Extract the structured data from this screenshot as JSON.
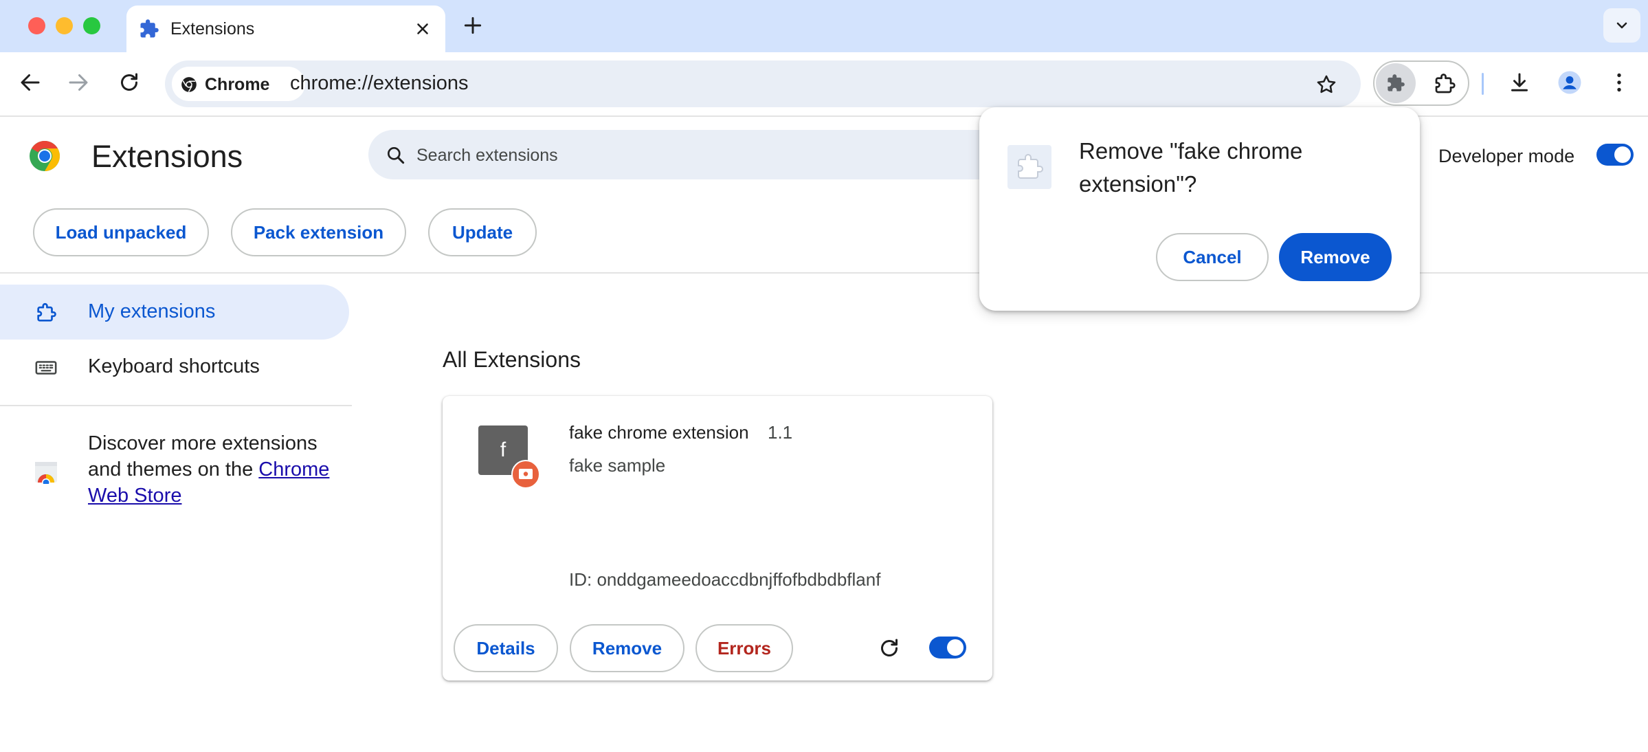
{
  "colors": {
    "accent": "#0b57d0",
    "tabstrip_bg": "#d3e3fd",
    "error_text": "#b3261e",
    "traffic_close": "#ff5f57",
    "traffic_min": "#febc2e",
    "traffic_max": "#28c840"
  },
  "browser": {
    "tab_title": "Extensions",
    "site_chip": "Chrome",
    "url": "chrome://extensions"
  },
  "page": {
    "title": "Extensions",
    "search_placeholder": "Search extensions",
    "developer_mode_label": "Developer mode",
    "developer_mode_on": true,
    "actions": {
      "load_unpacked": "Load unpacked",
      "pack_extension": "Pack extension",
      "update": "Update"
    }
  },
  "sidebar": {
    "items": [
      {
        "label": "My extensions",
        "icon": "extension-icon",
        "active": true
      },
      {
        "label": "Keyboard shortcuts",
        "icon": "keyboard-icon",
        "active": false
      }
    ],
    "discover_text": "Discover more extensions and themes on the ",
    "store_link": "Chrome Web Store"
  },
  "main": {
    "section_title": "All Extensions",
    "extension": {
      "icon_letter": "f",
      "name": "fake chrome extension",
      "version": "1.1",
      "description": "fake sample",
      "id_text": "ID: onddgameedoaccdbnjffofbdbdbflanf",
      "enabled": true,
      "buttons": {
        "details": "Details",
        "remove": "Remove",
        "errors": "Errors"
      }
    }
  },
  "dialog": {
    "title": "Remove \"fake chrome extension\"?",
    "cancel": "Cancel",
    "confirm": "Remove"
  }
}
